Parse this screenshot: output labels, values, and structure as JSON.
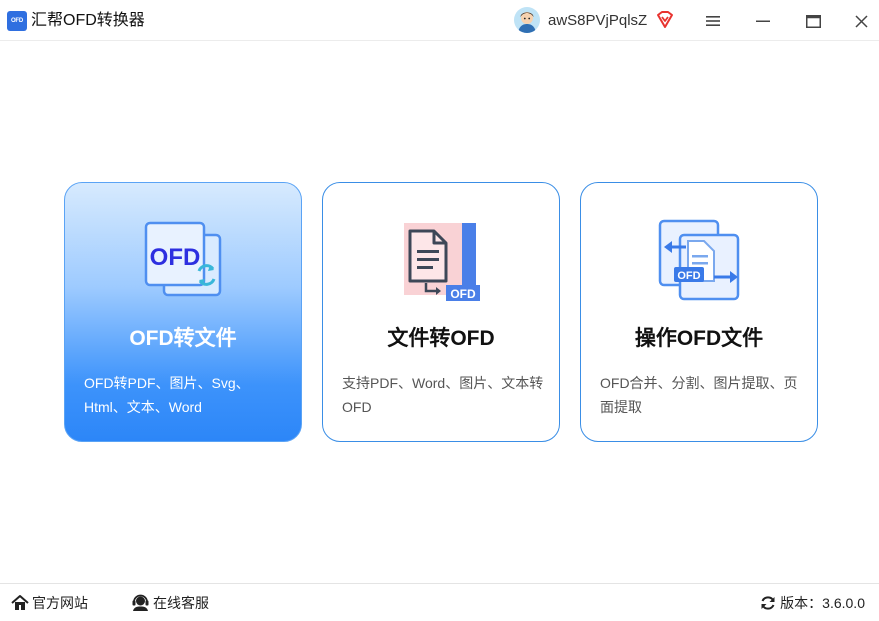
{
  "app": {
    "logo_text": "OFD",
    "title": "汇帮OFD转换器"
  },
  "user": {
    "name": "awS8PVjPqlsZ"
  },
  "icons": {
    "avatar": "avatar-icon",
    "vip": "diamond-icon",
    "menu": "menu-icon",
    "minimize": "minimize-icon",
    "maximize": "maximize-icon",
    "close": "close-icon",
    "home": "home-icon",
    "service": "headset-icon",
    "refresh": "refresh-icon"
  },
  "colors": {
    "accent": "#2c86f8",
    "card_border": "#3a8ee6",
    "vip": "#e8332f"
  },
  "cards": [
    {
      "title": "OFD转文件",
      "desc": "OFD转PDF、图片、Svg、Html、文本、Word",
      "icon_text": "OFD",
      "icon": "ofd-to-file-icon",
      "selected": true
    },
    {
      "title": "文件转OFD",
      "desc": "支持PDF、Word、图片、文本转OFD",
      "icon_text": "OFD",
      "icon": "file-to-ofd-icon",
      "selected": false
    },
    {
      "title": "操作OFD文件",
      "desc": "OFD合并、分割、图片提取、页面提取",
      "icon_text": "OFD",
      "icon": "ofd-operate-icon",
      "selected": false
    }
  ],
  "footer": {
    "website_label": "官方网站",
    "service_label": "在线客服",
    "version_label": "版本：3.6.0.0"
  }
}
